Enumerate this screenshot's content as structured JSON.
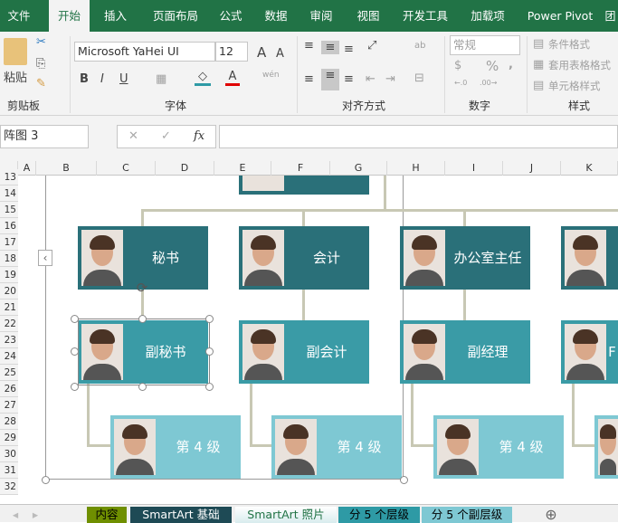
{
  "menu": {
    "tabs": [
      "文件",
      "开始",
      "插入",
      "页面布局",
      "公式",
      "数据",
      "审阅",
      "视图",
      "开发工具",
      "加载项",
      "Power Pivot",
      "团"
    ],
    "active": "开始"
  },
  "ribbon": {
    "clipboard": {
      "paste": "粘贴",
      "label": "剪贴板"
    },
    "font": {
      "name": "Microsoft YaHei UI",
      "size": "12",
      "label": "字体",
      "bold": "B",
      "italic": "I",
      "underline": "U",
      "font_color": "A",
      "phonetic": "wén"
    },
    "alignment": {
      "label": "对齐方式"
    },
    "number": {
      "format": "常规",
      "label": "数字",
      "percent": "%",
      "comma": ","
    },
    "styles": {
      "conditional": "条件格式",
      "table": "套用表格格式",
      "cell": "单元格样式",
      "label": "样式"
    },
    "colors": {
      "fill": "#2e9aa5",
      "font": "#e00000"
    }
  },
  "formula_bar": {
    "name_box": "阵图 3",
    "fx": "fx",
    "cancel": "✕",
    "enter": "✓",
    "value": ""
  },
  "columns": [
    "A",
    "B",
    "C",
    "D",
    "E",
    "F",
    "G",
    "H",
    "I",
    "J",
    "K"
  ],
  "rows": [
    "13",
    "14",
    "15",
    "16",
    "17",
    "18",
    "19",
    "20",
    "21",
    "22",
    "23",
    "24",
    "25",
    "26",
    "27",
    "28",
    "29",
    "30",
    "31",
    "32"
  ],
  "smartart": {
    "level2": [
      "秘书",
      "会计",
      "办公室主任",
      ""
    ],
    "level3": [
      "副秘书",
      "副会计",
      "副经理",
      "F"
    ],
    "level4": [
      "第 4 级",
      "第 4 级",
      "第 4 级"
    ],
    "colors": {
      "level2": "#2a7079",
      "level3": "#3a9ba6",
      "level4": "#7ec8d3",
      "connector": "#c8c8b4"
    }
  },
  "sheet_tabs": [
    {
      "label": "内容",
      "color": "#6f8f00"
    },
    {
      "label": "SmartArt 基础",
      "color": "#1e4a55"
    },
    {
      "label": "SmartArt 照片",
      "color": "#ffffff",
      "active": true
    },
    {
      "label": "分 5 个层级",
      "color": "#2e9aa5"
    },
    {
      "label": "分 5 个副层级",
      "color": "#7ec8d3"
    }
  ]
}
